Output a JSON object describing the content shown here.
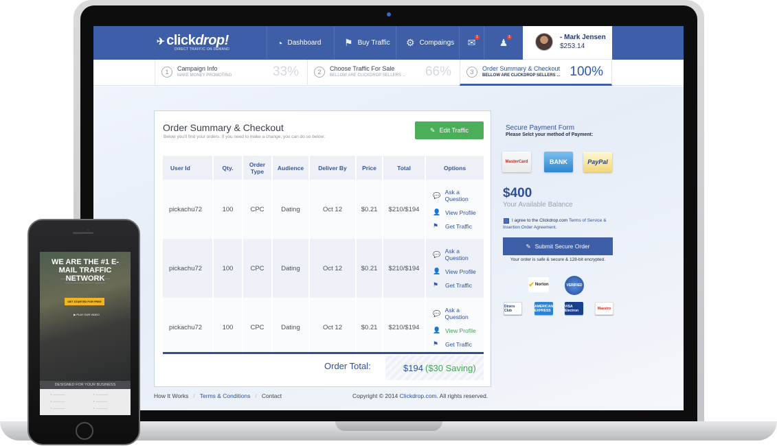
{
  "brand": {
    "logo": "clickdrop!",
    "logo_main": "click",
    "logo_accent": "drop!",
    "tagline": "DIRECT TRAFFIC ON DEMAND",
    "accent_color": "#3e5fa8",
    "success_color": "#4cae59"
  },
  "nav": {
    "items": [
      {
        "label": "Dashboard",
        "icon": "speedometer-icon"
      },
      {
        "label": "Buy Traffic",
        "icon": "signpost-icon"
      },
      {
        "label": "Compaings",
        "icon": "gear-icon"
      }
    ],
    "mail_icon": "mail-icon",
    "mail_badge": "1",
    "notify_icon": "notification-icon",
    "notify_badge": "1"
  },
  "user": {
    "name": "- Mark Jensen",
    "balance": "$253.14"
  },
  "steps": [
    {
      "num": "1",
      "title": "Campaign Info",
      "sub": "MAKE MONEY PROMOTING",
      "pct": "33%"
    },
    {
      "num": "2",
      "title": "Choose Traffic For Sale",
      "sub": "BELLOW ARE CLICKDROP SELLERS ...",
      "pct": "66%"
    },
    {
      "num": "3",
      "title": "Order Summary & Checkout",
      "sub": "BELLOW ARE CLICKDROP SELLERS ...",
      "pct": "100%"
    }
  ],
  "order": {
    "title": "Order Summary & Checkout",
    "subtitle": "Below you'll find your orders. If you need to make a change, you can do so below:",
    "edit_label": "Edit Traffic",
    "columns": [
      "User Id",
      "Qty.",
      "Order Type",
      "Audience",
      "Deliver By",
      "Price",
      "Total",
      "Options"
    ],
    "rows": [
      {
        "user": "pickachu72",
        "qty": "100",
        "type": "CPC",
        "audience": "Dating",
        "deliver": "Oct 12",
        "price": "$0.21",
        "total": "$210/$194"
      },
      {
        "user": "pickachu72",
        "qty": "100",
        "type": "CPC",
        "audience": "Dating",
        "deliver": "Oct 12",
        "price": "$0.21",
        "total": "$210/$194"
      },
      {
        "user": "pickachu72",
        "qty": "100",
        "type": "CPC",
        "audience": "Dating",
        "deliver": "Oct 12",
        "price": "$0.21",
        "total": "$210/$194"
      }
    ],
    "options": {
      "ask": "Ask a Question",
      "view": "View Profile",
      "get": "Get Traffic"
    },
    "total_label": "Order Total:",
    "total_value": "$194",
    "total_saving": "($30 Saving)"
  },
  "payment": {
    "title": "Secure Payment Form",
    "subtitle": "Please Selct your method of Payment:",
    "methods": [
      "MasterCard",
      "BANK",
      "PayPal"
    ],
    "balance_amount": "$400",
    "balance_label": "Your Available Balance",
    "agree_prefix": "I agree to the Clickdrop.com",
    "agree_link": "Terms of Service & Insertion Order Agreement",
    "agree_suffix": ".",
    "submit_label": "Submit Secure Order",
    "secure_note": "Your order is safe & secure & 128-bit encrypted.",
    "seals": [
      "Norton",
      "VERIFIED"
    ],
    "cards": [
      "Diners Club",
      "AMERICAN EXPRESS",
      "VISA Electron",
      "Maestro"
    ]
  },
  "footer": {
    "links": [
      "How It Works",
      "Terms & Conditions",
      "Contact"
    ],
    "copy_prefix": "Copyright © 2014",
    "copy_brand": "Clickdrop.com",
    "copy_suffix": ". All rights reserved."
  },
  "phone": {
    "headline": "WE ARE THE #1 E-MAIL TRAFFIC NETWORK",
    "cta": "GET STARTED FOR FREE",
    "play": "PLAY OUR VIDEO",
    "bar": "DESIGNED FOR YOUR BUSINESS"
  }
}
